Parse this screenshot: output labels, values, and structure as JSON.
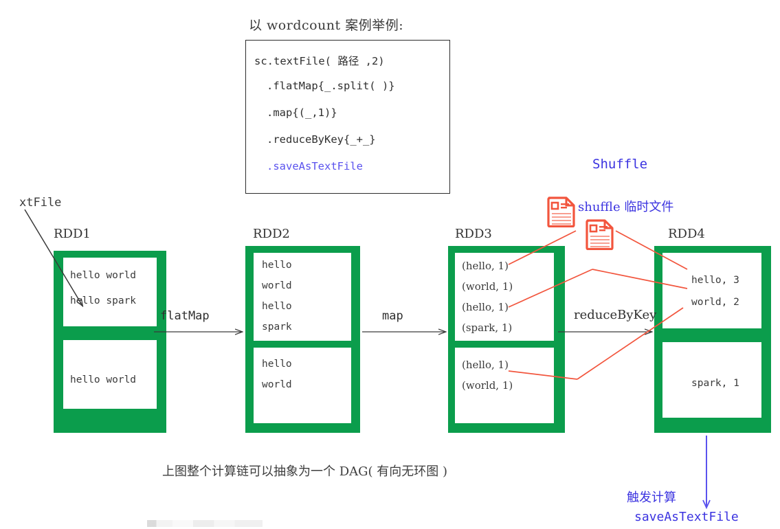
{
  "headline": "以 wordcount 案例举例:",
  "code_block": {
    "lines": [
      {
        "text": "sc.textFile( 路径 ,2)",
        "color": "#2f2f2f",
        "indent": 0
      },
      {
        "text": ".flatMap{_.split( )}",
        "color": "#2f2f2f",
        "indent": 1
      },
      {
        "text": ".map{(_,1)}",
        "color": "#2f2f2f",
        "indent": 1
      },
      {
        "text": ".reduceByKey{_+_}",
        "color": "#2f2f2f",
        "indent": 1
      },
      {
        "text": ".saveAsTextFile",
        "color": "#5a52ee",
        "indent": 1
      }
    ]
  },
  "source_label": "xtFile",
  "rdds": [
    {
      "name": "RDD1",
      "partitions": [
        {
          "rows": [
            "hello world",
            "hello spark"
          ]
        },
        {
          "rows": [
            "hello world"
          ]
        }
      ]
    },
    {
      "name": "RDD2",
      "partitions": [
        {
          "rows": [
            "hello",
            "world",
            "hello",
            "spark"
          ]
        },
        {
          "rows": [
            "hello",
            "world"
          ]
        }
      ]
    },
    {
      "name": "RDD3",
      "partitions": [
        {
          "rows": [
            "(hello, 1)",
            "(world, 1)",
            "(hello, 1)",
            "(spark, 1)"
          ]
        },
        {
          "rows": [
            "(hello, 1)",
            "(world, 1)"
          ]
        }
      ]
    },
    {
      "name": "RDD4",
      "partitions": [
        {
          "rows": [
            "hello, 3",
            "world, 2"
          ]
        },
        {
          "rows": [
            "spark, 1"
          ]
        }
      ]
    }
  ],
  "transforms": [
    {
      "label": "flatMap"
    },
    {
      "label": "map"
    },
    {
      "label": "reduceByKey"
    }
  ],
  "annotations": {
    "shuffle_title": "Shuffle",
    "shuffle_temp_files": "shuffle 临时文件",
    "trigger_compute": "触发计算",
    "save_action": "saveAsTextFile",
    "caption": "上图整个计算链可以抽象为一个 DAG( 有向无环图 )"
  },
  "colors": {
    "partition_green": "#0b9d4c",
    "shuffle_red": "#f2553d",
    "annotation_blue": "#3b33e0",
    "code_highlight": "#5a52ee",
    "line_black": "#3a3a3a"
  },
  "icons": {
    "shuffle_file": "document-icon"
  }
}
